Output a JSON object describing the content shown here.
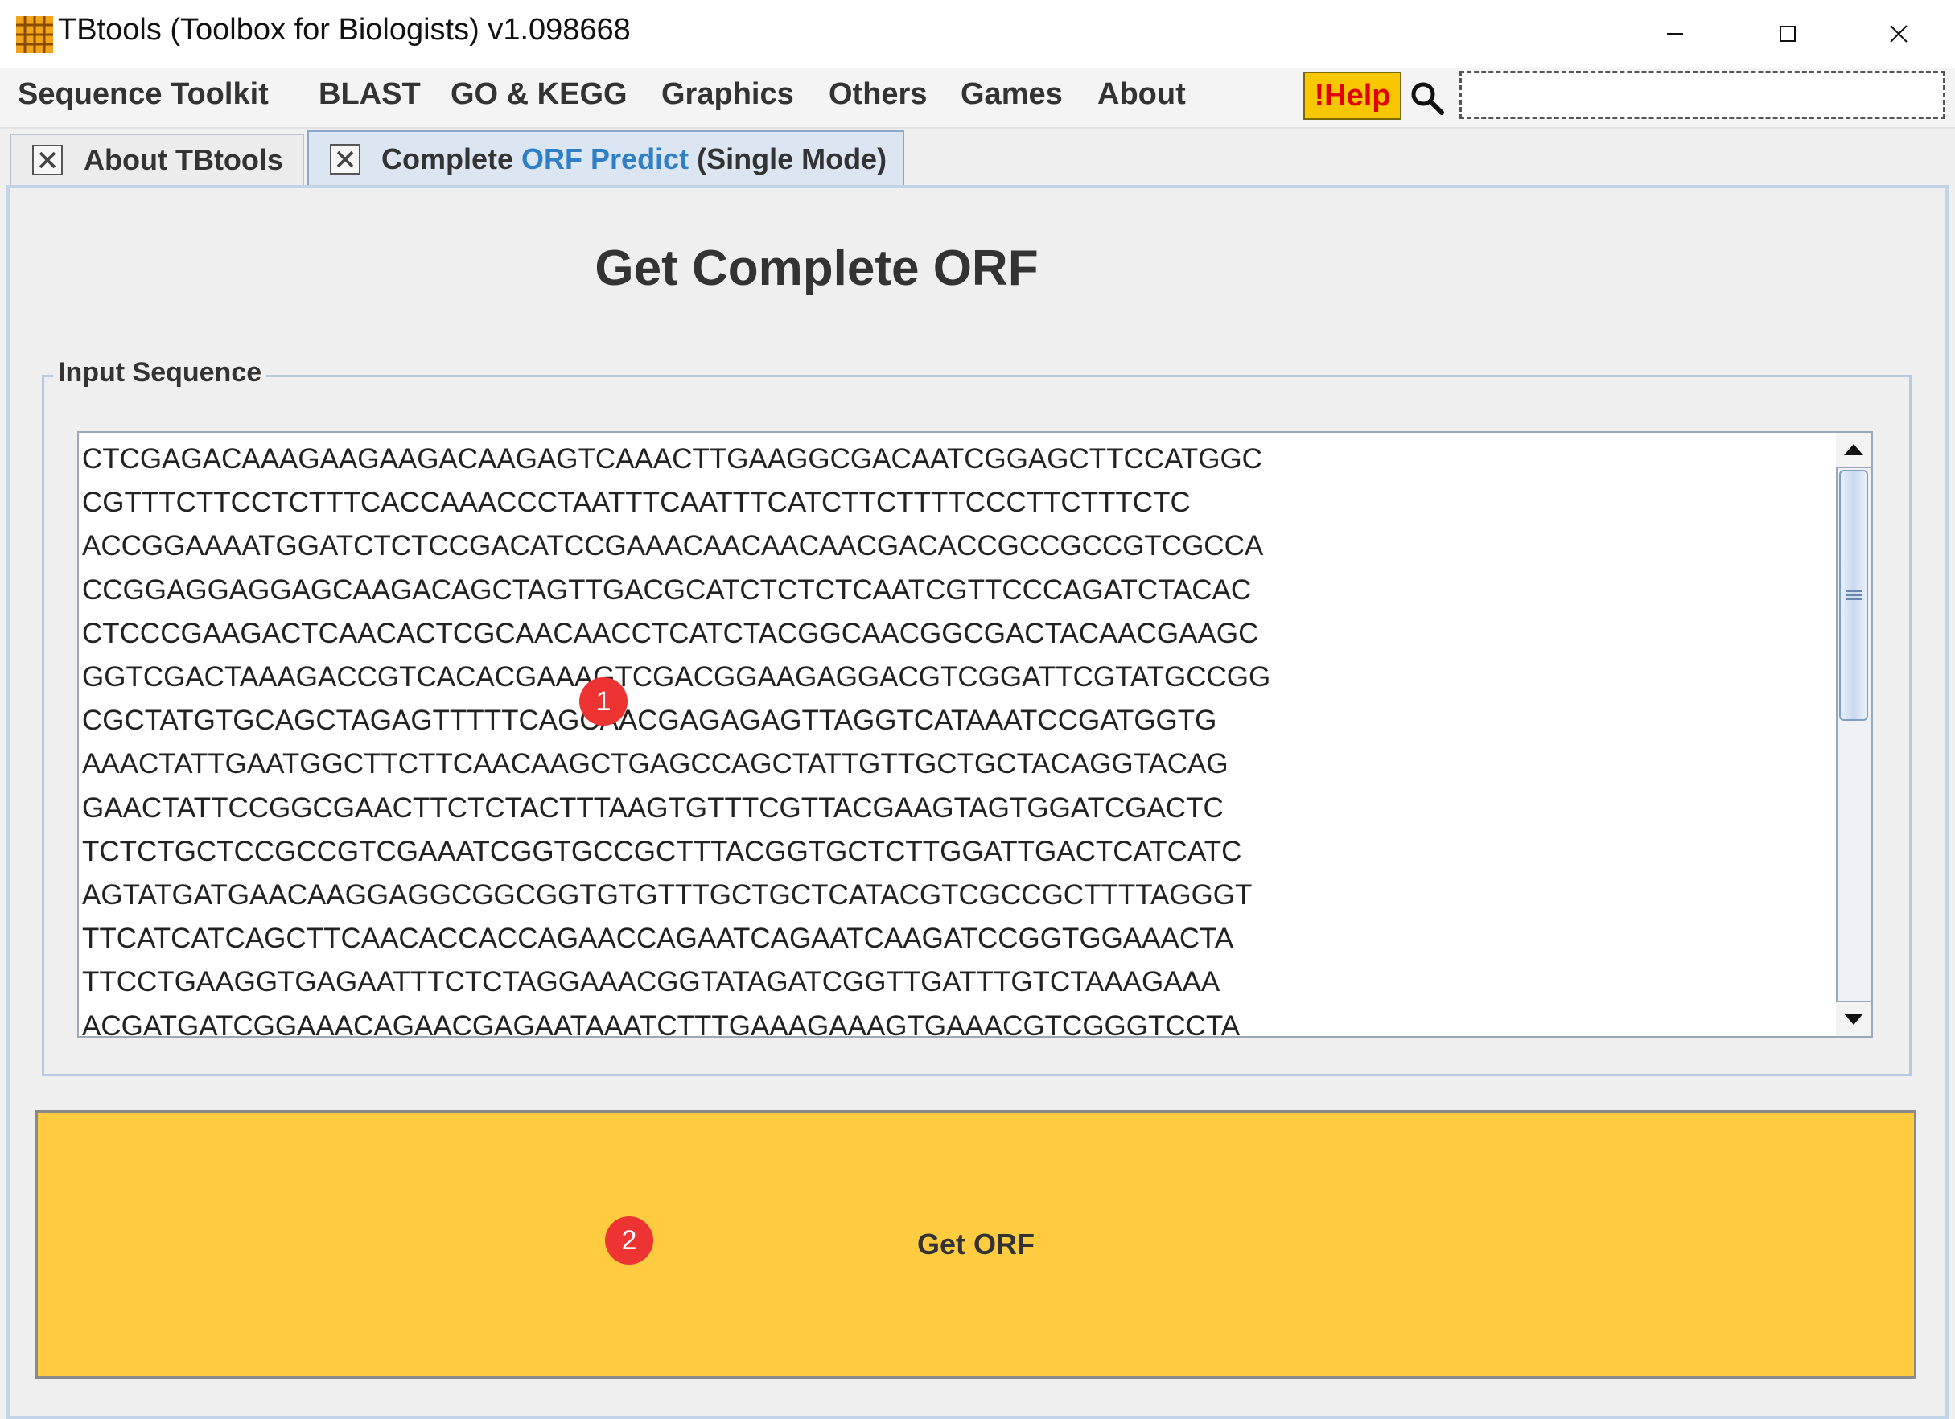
{
  "window": {
    "title": "TBtools (Toolbox for Biologists) v1.098668"
  },
  "menu": {
    "items": [
      "Sequence Toolkit",
      "BLAST",
      "GO & KEGG",
      "Graphics",
      "Others",
      "Games",
      "About"
    ],
    "help_label": "!Help",
    "search_placeholder": ""
  },
  "tabs": [
    {
      "label": "About TBtools",
      "active": false
    },
    {
      "label_part1": "Complete ",
      "label_highlight": "ORF Predict",
      "label_part2": " (Single Mode)",
      "active": true
    }
  ],
  "main": {
    "heading": "Get Complete ORF",
    "group_title": "Input Sequence",
    "sequence_lines": [
      "CTCGAGACAAAGAAGAAGACAAGAGTCAAACTTGAAGGCGACAATCGGAGCTTCCATGGC",
      "CGTTTCTTCCTCTTTCACCAAACCCTAATTTCAATTTCATCTTCTTTTCCCTTCTTTCTC",
      "ACCGGAAAATGGATCTCTCCGACATCCGAAACAACAACAACGACACCGCCGCCGTCGCCA",
      "CCGGAGGAGGAGCAAGACAGCTAGTTGACGCATCTCTCTCAATCGTTCCCAGATCTACAC",
      "CTCCCGAAGACTCAACACTCGCAACAACCTCATCTACGGCAACGGCGACTACAACGAAGC",
      "GGTCGACTAAAGACCGTCACACGAAAGTCGACGGAAGAGGACGTCGGATTCGTATGCCGG",
      "CGCTATGTGCAGCTAGAGTTTTTCAGCAACGAGAGAGTTAGGTCATAAATCCGATGGTG",
      "AAACTATTGAATGGCTTCTTCAACAAGCTGAGCCAGCTATTGTTGCTGCTACAGGTACAG",
      "GAACTATTCCGGCGAACTTCTCTACTTTAAGTGTTTCGTTACGAAGTAGTGGATCGACTC",
      "TCTCTGCTCCGCCGTCGAAATCGGTGCCGCTTTACGGTGCTCTTGGATTGACTCATCATC",
      "AGTATGATGAACAAGGAGGCGGCGGTGTGTTTGCTGCTCATACGTCGCCGCTTTTAGGGT",
      "TTCATCATCAGCTTCAACACCACCAGAACCAGAATCAGAATCAAGATCCGGTGGAAACTA",
      "TTCCTGAAGGTGAGAATTTCTCTAGGAAACGGTATAGATCGGTTGATTTGTCTAAAGAAA",
      "ACGATGATCGGAAACAGAACGAGAATAAATCTTTGAAAGAAAGTGAAACGTCGGGTCCTA"
    ],
    "button_label": "Get ORF"
  },
  "annotations": {
    "step1": "1",
    "step2": "2"
  },
  "colors": {
    "button_bg": "#ffcc40",
    "help_bg": "#f7c800",
    "help_text": "#e00000",
    "tab_highlight": "#2e7fc6",
    "step_marker": "#ee3333"
  }
}
